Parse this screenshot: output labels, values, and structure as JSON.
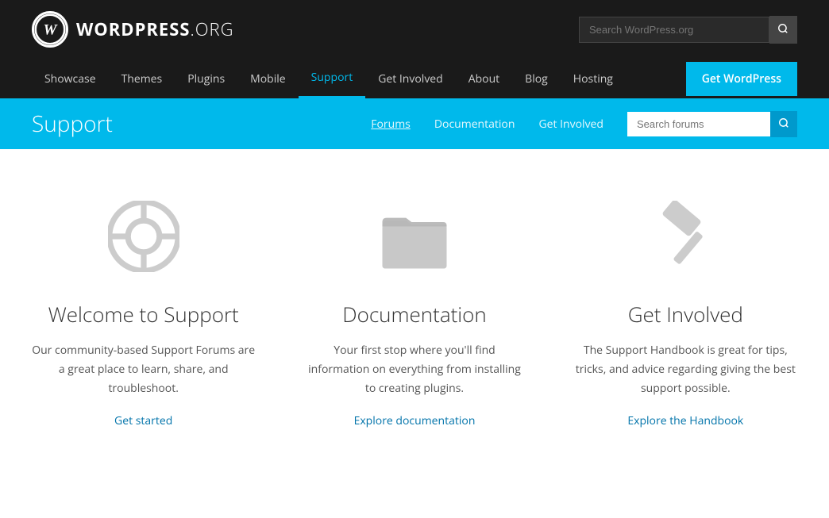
{
  "site": {
    "logo_text_bold": "WordPress",
    "logo_text_light": ".org",
    "logo_symbol": "W"
  },
  "top_search": {
    "placeholder": "Search WordPress.org"
  },
  "main_nav": {
    "links": [
      {
        "id": "showcase",
        "label": "Showcase",
        "active": false
      },
      {
        "id": "themes",
        "label": "Themes",
        "active": false
      },
      {
        "id": "plugins",
        "label": "Plugins",
        "active": false
      },
      {
        "id": "mobile",
        "label": "Mobile",
        "active": false
      },
      {
        "id": "support",
        "label": "Support",
        "active": true
      },
      {
        "id": "get-involved",
        "label": "Get Involved",
        "active": false
      },
      {
        "id": "about",
        "label": "About",
        "active": false
      },
      {
        "id": "blog",
        "label": "Blog",
        "active": false
      },
      {
        "id": "hosting",
        "label": "Hosting",
        "active": false
      }
    ],
    "cta_label": "Get WordPress"
  },
  "support_header": {
    "title": "Support",
    "nav_links": [
      {
        "id": "forums",
        "label": "Forums",
        "active": true
      },
      {
        "id": "documentation",
        "label": "Documentation",
        "active": false
      },
      {
        "id": "get-involved",
        "label": "Get Involved",
        "active": false
      }
    ],
    "search_placeholder": "Search forums"
  },
  "cards": [
    {
      "id": "welcome",
      "icon": "lifesaver",
      "title": "Welcome to Support",
      "description": "Our community-based Support Forums are a great place to learn, share, and troubleshoot.",
      "link_label": "Get started",
      "link_href": "#"
    },
    {
      "id": "documentation",
      "icon": "folder",
      "title": "Documentation",
      "description": "Your first stop where you'll find information on everything from installing to creating plugins.",
      "link_label": "Explore documentation",
      "link_href": "#"
    },
    {
      "id": "get-involved",
      "icon": "hammer",
      "title": "Get Involved",
      "description": "The Support Handbook is great for tips, tricks, and advice regarding giving the best support possible.",
      "link_label": "Explore the Handbook",
      "link_href": "#"
    }
  ]
}
